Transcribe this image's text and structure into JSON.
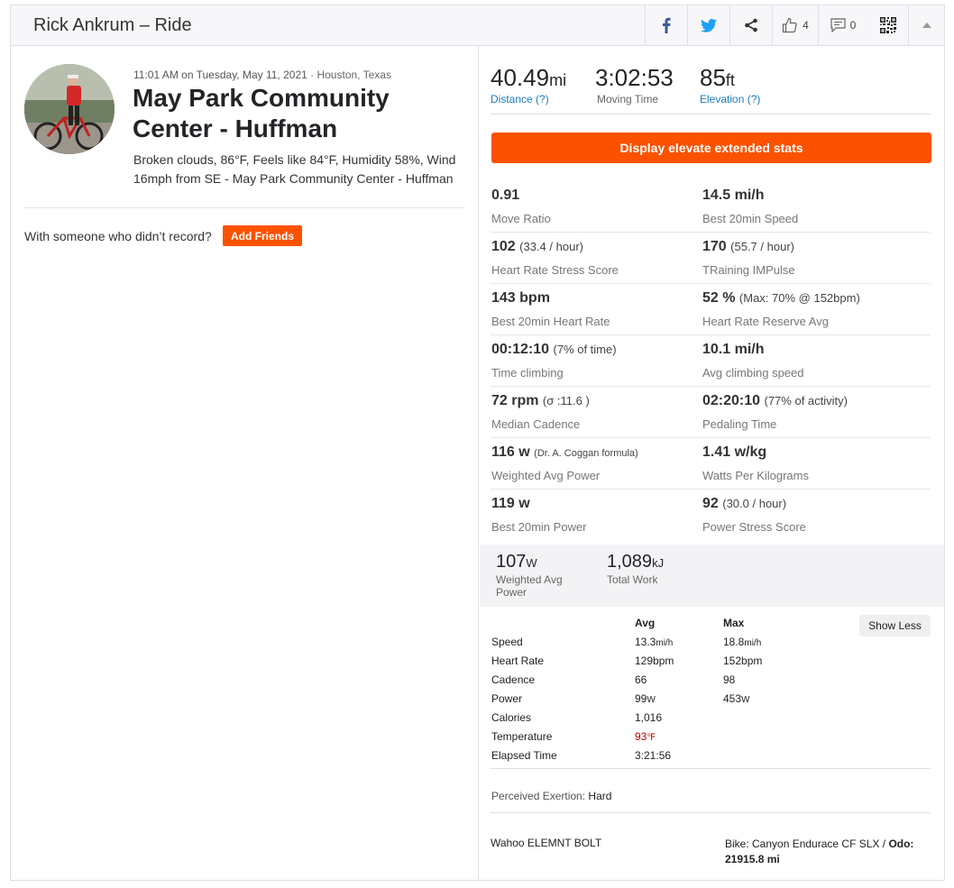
{
  "header": {
    "title": "Rick Ankrum – Ride",
    "kudos_count": "4",
    "comments_count": "0",
    "icons": [
      "facebook-icon",
      "twitter-icon",
      "share-icon",
      "kudos-thumb-icon",
      "comment-icon",
      "qr-code-icon",
      "collapse-caret-icon"
    ]
  },
  "activity": {
    "datetime": "11:01 AM on Tuesday, May 11, 2021",
    "separator": " · ",
    "location": "Houston, Texas",
    "name": "May Park Community Center - Huffman",
    "weather": "Broken clouds, 86°F, Feels like 84°F, Humidity 58%, Wind 16mph from SE - May Park Community Center - Huffman"
  },
  "friends": {
    "prompt": "With someone who didn’t record?",
    "button": "Add Friends"
  },
  "inline_stats": [
    {
      "value": "40.49",
      "unit": "mi",
      "label": "Distance (?)"
    },
    {
      "value": "3:02:53",
      "unit": "",
      "label": "Moving Time"
    },
    {
      "value": "85",
      "unit": "ft",
      "label": "Elevation (?)"
    }
  ],
  "elevate_button": "Display elevate extended stats",
  "extended_stats": [
    {
      "value": "0.91",
      "extra": "",
      "label": "Move Ratio"
    },
    {
      "value": "14.5 mi/h",
      "extra": "",
      "label": "Best 20min Speed"
    },
    {
      "value": "102",
      "extra": "(33.4 / hour)",
      "label": "Heart Rate Stress Score"
    },
    {
      "value": "170",
      "extra": "(55.7 / hour)",
      "label": "TRaining IMPulse"
    },
    {
      "value": "143 bpm",
      "extra": "",
      "label": "Best 20min Heart Rate"
    },
    {
      "value": "52 %",
      "extra": "(Max: 70% @ 152bpm)",
      "label": "Heart Rate Reserve Avg"
    },
    {
      "value": "00:12:10",
      "extra": "(7% of time)",
      "label": "Time climbing"
    },
    {
      "value": "10.1 mi/h",
      "extra": "",
      "label": "Avg climbing speed"
    },
    {
      "value": "72 rpm",
      "extra": "(σ :11.6 )",
      "label": "Median Cadence"
    },
    {
      "value": "02:20:10",
      "extra": "(77% of activity)",
      "label": "Pedaling Time"
    },
    {
      "value": "116 w",
      "extra": "(Dr. A. Coggan formula)",
      "label": "Weighted Avg Power"
    },
    {
      "value": "1.41 w/kg",
      "extra": "",
      "label": "Watts Per Kilograms"
    },
    {
      "value": "119 w",
      "extra": "",
      "label": "Best 20min Power"
    },
    {
      "value": "92",
      "extra": "(30.0 / hour)",
      "label": "Power Stress Score"
    }
  ],
  "power_summary": [
    {
      "value": "107",
      "unit": "W",
      "label": "Weighted Avg Power"
    },
    {
      "value": "1,089",
      "unit": "kJ",
      "label": "Total Work"
    }
  ],
  "more_stats": {
    "col_avg": "Avg",
    "col_max": "Max",
    "show_less": "Show Less",
    "rows": [
      {
        "label": "Speed",
        "avg": "13.3",
        "avg_unit": "mi/h",
        "max": "18.8",
        "max_unit": "mi/h"
      },
      {
        "label": "Heart Rate",
        "avg": "129bpm",
        "avg_unit": "",
        "max": "152bpm",
        "max_unit": ""
      },
      {
        "label": "Cadence",
        "avg": "66",
        "avg_unit": "",
        "max": "98",
        "max_unit": ""
      },
      {
        "label": "Power",
        "avg": "99",
        "avg_unit": "W",
        "max": "453",
        "max_unit": "W"
      },
      {
        "label": "Calories",
        "avg": "1,016",
        "avg_unit": "",
        "max": "",
        "max_unit": ""
      },
      {
        "label": "Temperature",
        "avg": "93",
        "avg_unit": "℉",
        "max": "",
        "max_unit": ""
      },
      {
        "label": "Elapsed Time",
        "avg": "3:21:56",
        "avg_unit": "",
        "max": "",
        "max_unit": ""
      }
    ],
    "temperature_color": "#c00000"
  },
  "perceived": {
    "label": "Perceived Exertion:",
    "value": "Hard"
  },
  "device": "Wahoo ELEMNT BOLT",
  "bike": {
    "text": "Bike: Canyon Endurace CF SLX / ",
    "odo_label": "Odo:",
    "odo_value": "21915.8 mi"
  },
  "colors": {
    "brand_orange": "#fc5200",
    "link_blue": "#1e7bbf",
    "facebook": "#3b5998",
    "twitter": "#1da1f2"
  }
}
